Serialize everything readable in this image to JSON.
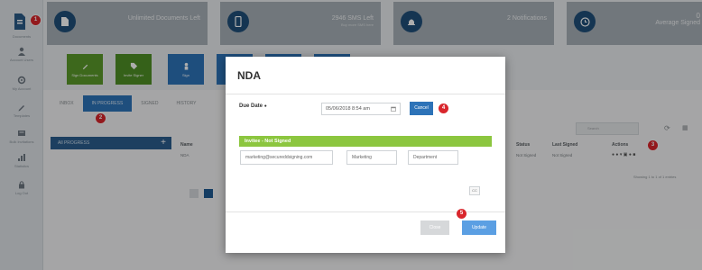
{
  "sidebar": {
    "items": [
      {
        "label": "Documents",
        "icon": "document-icon"
      },
      {
        "label": "Account Users",
        "icon": "user-icon"
      },
      {
        "label": "My Account",
        "icon": "gear-icon"
      },
      {
        "label": "Templates",
        "icon": "pencil-icon"
      },
      {
        "label": "Bulk Invitations",
        "icon": "inbox-icon"
      },
      {
        "label": "Statistics",
        "icon": "chart-icon"
      },
      {
        "label": "Log Out",
        "icon": "lock-icon"
      }
    ]
  },
  "badges": {
    "b1": "1",
    "b2": "2",
    "b3": "3",
    "b4": "4",
    "b5": "5"
  },
  "stats": {
    "documents_left": "Unlimited Documents Left",
    "sms_left": "2946 SMS Left",
    "sms_sub": "Buy more SMS here",
    "notifications": "2 Notifications",
    "average_signed_value": "0",
    "average_signed": "Average Signed"
  },
  "tiles": [
    {
      "label": "Sign Documents",
      "icon": "pen-icon"
    },
    {
      "label": "Invite Signer",
      "icon": "tag-icon"
    },
    {
      "label": "Sign",
      "icon": "person-icon"
    }
  ],
  "tabs": [
    "INBOX",
    "IN PROGRESS",
    "SIGNED",
    "HISTORY"
  ],
  "folder": {
    "label": "All PROGRESS",
    "plus": "+"
  },
  "table": {
    "headers": {
      "name": "Name",
      "status": "Status",
      "last_signed": "Last Signed",
      "actions": "Actions"
    },
    "row": {
      "name": "NDA",
      "status": "Not Signed",
      "last_signed": "Not Signed"
    }
  },
  "search": {
    "placeholder": "Search"
  },
  "showing": "Showing 1 to 1 of 1 entries",
  "modal": {
    "title": "NDA",
    "due_label": "Due Date",
    "due_value": "05/06/2018 8:54 am",
    "cancel_label": "Cancel",
    "invitee_status": "Invitee - Not Signed",
    "email": "marketing@secureddsigning.com",
    "role": "Marketing",
    "department": "Department",
    "small_btn": "CC",
    "close_label": "Close",
    "update_label": "Update"
  },
  "colors": {
    "accent": "#2d73b8",
    "badge": "#d9262c",
    "invitee_bar": "#8cc63f",
    "update_button": "#5b9fe3",
    "tile_green": "#5a9a2a",
    "tile_blue": "#2d73b8"
  }
}
